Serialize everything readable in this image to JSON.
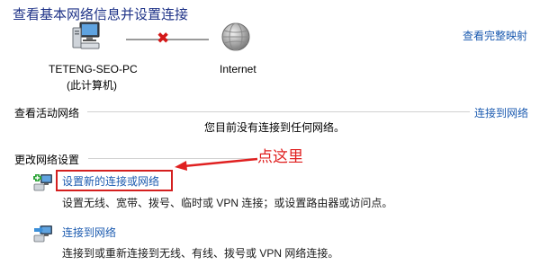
{
  "header": {
    "title": "查看基本网络信息并设置连接",
    "full_map_link": "查看完整映射"
  },
  "map": {
    "computer_name": "TETENG-SEO-PC",
    "computer_sub": "(此计算机)",
    "internet_label": "Internet"
  },
  "active_networks": {
    "label": "查看活动网络",
    "connect_link": "连接到网络",
    "status_text": "您目前没有连接到任何网络。"
  },
  "change_settings": {
    "label": "更改网络设置",
    "annotation": "点这里",
    "tasks": [
      {
        "title": "设置新的连接或网络",
        "desc": "设置无线、宽带、拨号、临时或 VPN 连接；或设置路由器或访问点。"
      },
      {
        "title": "连接到网络",
        "desc": "连接到或重新连接到无线、有线、拨号或 VPN 网络连接。"
      }
    ]
  },
  "colors": {
    "title": "#1e3287",
    "link": "#1c5bb0",
    "annotation": "#e02020",
    "disconnected_x": "#d41818"
  }
}
